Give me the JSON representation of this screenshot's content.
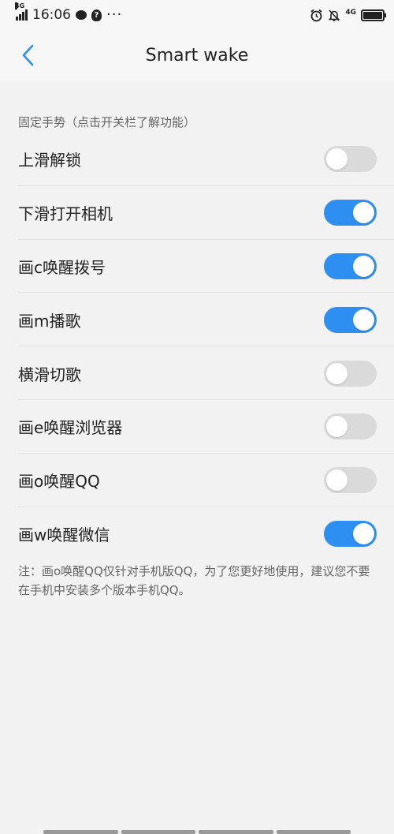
{
  "status_bar": {
    "network": "4G",
    "time": "16:06",
    "more": "···",
    "network_right": "4G"
  },
  "nav": {
    "title": "Smart wake"
  },
  "section": {
    "header": "固定手势（点击开关栏了解功能）"
  },
  "gestures": [
    {
      "label": "上滑解锁",
      "enabled": false
    },
    {
      "label": "下滑打开相机",
      "enabled": true
    },
    {
      "label": "画c唤醒拨号",
      "enabled": true
    },
    {
      "label": "画m播歌",
      "enabled": true
    },
    {
      "label": "横滑切歌",
      "enabled": false
    },
    {
      "label": "画e唤醒浏览器",
      "enabled": false
    },
    {
      "label": "画o唤醒QQ",
      "enabled": false
    },
    {
      "label": "画w唤醒微信",
      "enabled": true
    }
  ],
  "note": "注：画o唤醒QQ仅针对手机版QQ，为了您更好地使用，建议您不要在手机中安装多个版本手机QQ。",
  "colors": {
    "accent": "#2e8ff2",
    "toggle_off": "#dadada",
    "background": "#f2f2f2"
  }
}
